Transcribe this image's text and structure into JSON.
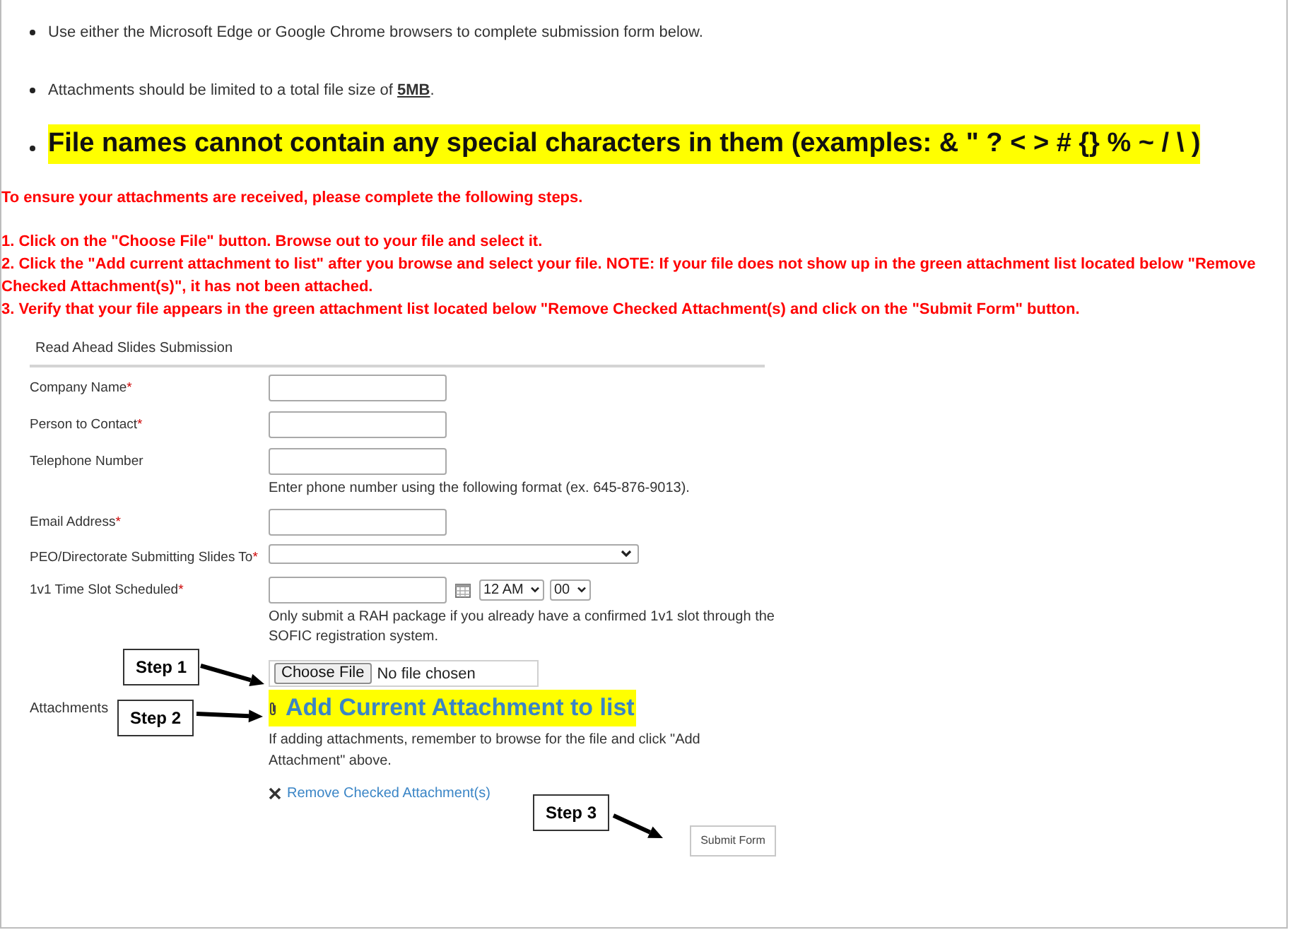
{
  "bullets": [
    {
      "kind": "normal",
      "text": "Use either the Microsoft Edge or Google Chrome browsers to complete submission form below."
    },
    {
      "kind": "normal",
      "text": "Attachments should be limited to a total file size of ",
      "emphasis": "5MB",
      "suffix": "."
    },
    {
      "kind": "highlight",
      "text": "File names cannot contain any special characters in them (examples: & \" ? < > # {} % ~ / \\ )"
    }
  ],
  "instructions": {
    "intro": "To ensure your attachments are received, please complete the following steps.",
    "steps": [
      "1. Click on the \"Choose File\" button.  Browse out to your file and select it.",
      "2. Click the \"Add current attachment to list\" after you browse and select your file.  NOTE: If your file does not show up in the green attachment list located below \"Remove Checked Attachment(s)\", it has not been attached.",
      "3. Verify that your file appears in the green attachment list located below \"Remove Checked Attachment(s) and click on the \"Submit Form\" button."
    ]
  },
  "form": {
    "title": "Read Ahead Slides Submission",
    "fields": [
      {
        "kind": "text",
        "label": "Company Name",
        "required_mark": "*"
      },
      {
        "kind": "text",
        "label": "Person to Contact",
        "required_mark": "*"
      },
      {
        "kind": "text",
        "label": "Telephone Number",
        "hint": "Enter phone number using the following format (ex. 645-876-9013)."
      },
      {
        "kind": "text",
        "label": "Email Address",
        "required_mark": "*"
      },
      {
        "kind": "select",
        "label": "PEO/Directorate Submitting Slides To",
        "required_mark": "*"
      },
      {
        "kind": "datetime",
        "label": "1v1 Time Slot Scheduled",
        "required_mark": "*",
        "hour": "12 AM",
        "minute": "00",
        "hint": "Only submit a RAH package if you already have a confirmed 1v1 slot through the SOFIC registration system."
      }
    ],
    "attachments": {
      "label": "Attachments",
      "choose_button": "Choose File",
      "file_status": "No file chosen",
      "add_link": "Add Current Attachment to list",
      "hint": "If adding attachments, remember to browse for the file and click \"Add Attachment\" above.",
      "remove_link": "Remove Checked Attachment(s)"
    },
    "submit": "Submit Form"
  },
  "callouts": [
    {
      "label": "Step 1"
    },
    {
      "label": "Step 2"
    },
    {
      "label": "Step 3"
    }
  ]
}
